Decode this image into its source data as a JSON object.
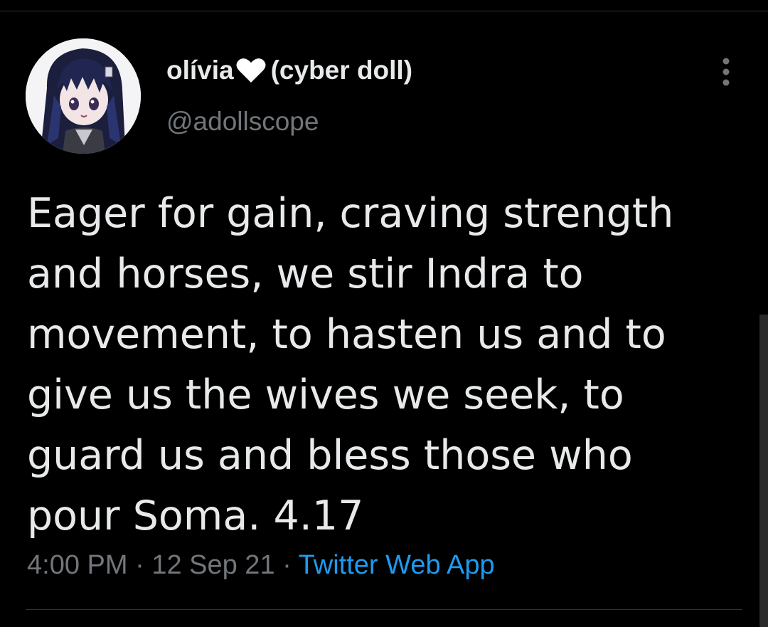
{
  "tweet": {
    "author": {
      "display_name": "olívia",
      "display_name_suffix": "(cyber doll)",
      "handle": "@adollscope",
      "name_emoji": "white-heart-icon"
    },
    "text": "Eager for gain, craving strength\nand horses, we stir Indra to\nmovement, to hasten us and to\ngive us the wives we seek, to\nguard us and bless those who\npour Soma. 4.17",
    "time": "4:00 PM",
    "separator": "·",
    "date": "12 Sep 21",
    "source": "Twitter Web App"
  },
  "icons": {
    "more": "more-vertical-icon",
    "heart": "white-heart-icon"
  },
  "colors": {
    "background": "#000000",
    "text_primary": "#e7e9ea",
    "text_secondary": "#71767b",
    "link": "#1d9bf0",
    "divider": "#2f3336"
  }
}
